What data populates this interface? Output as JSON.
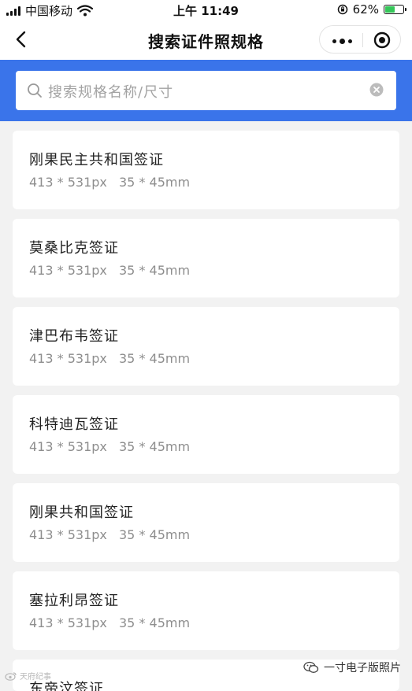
{
  "status_bar": {
    "carrier": "中国移动",
    "time": "上午 11:49",
    "battery_percent": "62%",
    "battery_level": 0.62,
    "icons": [
      "signal-icon",
      "wifi-icon",
      "rotation-lock-icon",
      "battery-icon"
    ]
  },
  "nav": {
    "title": "搜索证件照规格",
    "icons": [
      "back-icon",
      "more-icon",
      "target-icon"
    ]
  },
  "search": {
    "placeholder": "搜索规格名称/尺寸",
    "icons": [
      "search-icon",
      "clear-icon"
    ],
    "accent_color": "#3a74ea"
  },
  "items": [
    {
      "name": "刚果民主共和国签证",
      "px": "413 * 531px",
      "mm": "35 * 45mm"
    },
    {
      "name": "莫桑比克签证",
      "px": "413 * 531px",
      "mm": "35 * 45mm"
    },
    {
      "name": "津巴布韦签证",
      "px": "413 * 531px",
      "mm": "35 * 45mm"
    },
    {
      "name": "科特迪瓦签证",
      "px": "413 * 531px",
      "mm": "35 * 45mm"
    },
    {
      "name": "刚果共和国签证",
      "px": "413 * 531px",
      "mm": "35 * 45mm"
    },
    {
      "name": "塞拉利昂签证",
      "px": "413 * 531px",
      "mm": "35 * 45mm"
    },
    {
      "name": "东帝汶签证"
    }
  ],
  "watermarks": {
    "left": "天府纪事",
    "right": "一寸电子版照片"
  }
}
